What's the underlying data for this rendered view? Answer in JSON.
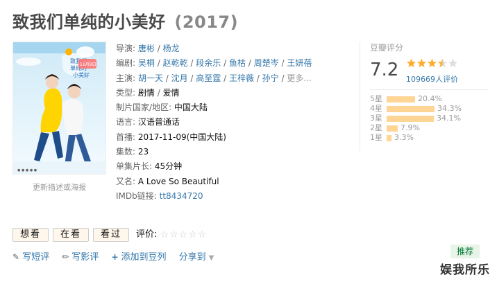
{
  "movie": {
    "title": "致我们单纯的小美好",
    "year": "(2017)"
  },
  "poster": {
    "link_text": "更新描述或海报",
    "badge": "11月9日"
  },
  "info": {
    "director_label": "导演:",
    "directors": [
      "唐彬",
      "杨龙"
    ],
    "writer_label": "编剧:",
    "writers": [
      "吴桐",
      "赵乾乾",
      "段余乐",
      "鱼枯",
      "周楚岑",
      "王妍蓓"
    ],
    "cast_label": "主演:",
    "cast": [
      "胡一天",
      "沈月",
      "高至霆",
      "王梓薇",
      "孙宁"
    ],
    "cast_more": "更多...",
    "genre_label": "类型:",
    "genres": [
      "剧情",
      "爱情"
    ],
    "country_label": "制片国家/地区:",
    "country": "中国大陆",
    "language_label": "语言:",
    "language": "汉语普通话",
    "premiere_label": "首播:",
    "premiere": "2017-11-09(中国大陆)",
    "episodes_label": "集数:",
    "episodes": "23",
    "runtime_label": "单集片长:",
    "runtime": "45分钟",
    "aka_label": "又名:",
    "aka": "A Love So Beautiful",
    "imdb_label": "IMDb链接:",
    "imdb": "tt8434720"
  },
  "rating": {
    "label": "豆瓣评分",
    "score": "7.2",
    "stars_value": 3.5,
    "count": "109669人评价",
    "breakdown": [
      {
        "label": "5星",
        "percent": "20.4%",
        "value": 20.4
      },
      {
        "label": "4星",
        "percent": "34.3%",
        "value": 34.3
      },
      {
        "label": "3星",
        "percent": "34.1%",
        "value": 34.1
      },
      {
        "label": "2星",
        "percent": "7.9%",
        "value": 7.9
      },
      {
        "label": "1星",
        "percent": "3.3%",
        "value": 3.3
      }
    ]
  },
  "actions": {
    "want": "想看",
    "watching": "在看",
    "watched": "看过",
    "rate_label": "评价:",
    "rate_stars": "☆☆☆☆☆"
  },
  "bottom": {
    "short_review": "写短评",
    "review": "写影评",
    "add_doulist": "添加到豆列",
    "share": "分享到",
    "recommend": "推荐"
  },
  "watermark": "娱我所乐",
  "colors": {
    "link": "#3377aa",
    "bar": "#ffd596",
    "star": "#ffac2d",
    "button_bg": "#fff6ec",
    "recommend_bg": "#e9f4e9"
  }
}
